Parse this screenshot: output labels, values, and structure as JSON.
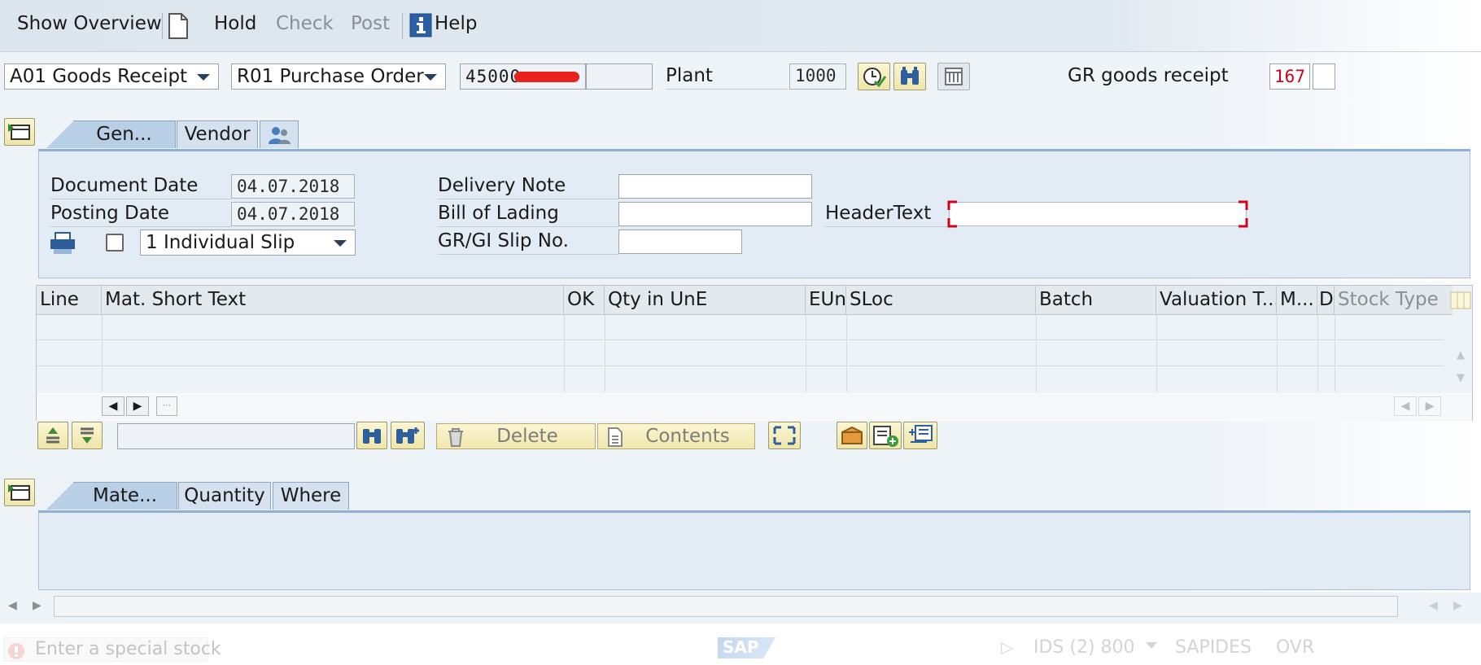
{
  "toolbar": {
    "show_overview": "Show Overview",
    "hold": "Hold",
    "check": "Check",
    "post": "Post",
    "help": "Help"
  },
  "header": {
    "transaction": "A01 Goods Receipt",
    "reference_doc": "R01 Purchase Order",
    "po_number": "45000",
    "plant_label": "Plant",
    "plant_value": "1000",
    "movement_label": "GR goods receipt",
    "movement_type": "167"
  },
  "header_tabs": [
    "Gen...",
    "Vendor"
  ],
  "general": {
    "document_date_label": "Document Date",
    "document_date": "04.07.2018",
    "posting_date_label": "Posting Date",
    "posting_date": "04.07.2018",
    "slip_type": "1 Individual Slip",
    "delivery_note_label": "Delivery Note",
    "bill_of_lading_label": "Bill of Lading",
    "header_text_label": "HeaderText",
    "gr_gi_slip_label": "GR/GI Slip No."
  },
  "grid": {
    "columns": [
      "Line",
      "Mat. Short Text",
      "OK",
      "Qty in UnE",
      "EUn",
      "SLoc",
      "Batch",
      "Valuation T...",
      "M...",
      "D",
      "Stock Type"
    ]
  },
  "grid_actions": {
    "delete": "Delete",
    "contents": "Contents"
  },
  "detail_tabs": [
    "Mate...",
    "Quantity",
    "Where"
  ],
  "status": {
    "message": "Enter a special stock",
    "system": "IDS (2) 800",
    "server": "SAPIDES",
    "mode": "OVR",
    "logo": "SAP"
  },
  "colors": {
    "accent_tab": "#8fb0d6",
    "icon_yellow": "#f2e7ad",
    "error_red": "#d0021b"
  }
}
